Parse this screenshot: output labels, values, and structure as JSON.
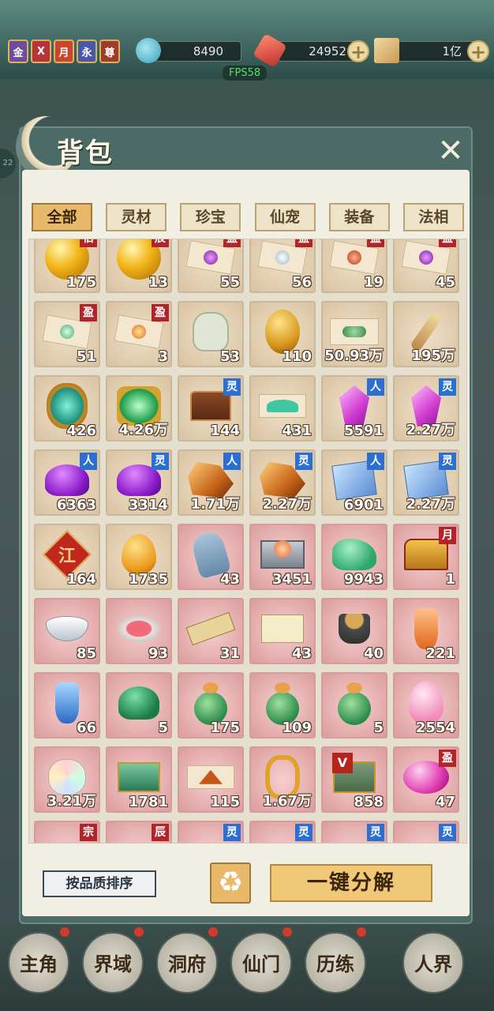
{
  "header": {
    "badges": [
      {
        "label": "金",
        "color": "#6e4b9c"
      },
      {
        "label": "X",
        "color": "#b8343a"
      },
      {
        "label": "月",
        "color": "#c9452f"
      },
      {
        "label": "永",
        "color": "#4a58a8"
      },
      {
        "label": "尊",
        "color": "#a03a2a"
      }
    ],
    "resources": [
      {
        "name": "spirit-jade",
        "value": "8490",
        "color": "#3aa0b8"
      },
      {
        "name": "red-crystal",
        "value": "24952",
        "color": "#d2453a"
      },
      {
        "name": "scroll",
        "value": "1亿",
        "color": "#d8b06a"
      }
    ],
    "plus_label": "+",
    "fps": "FPS58"
  },
  "panel": {
    "title": "背包",
    "close_label": "✕",
    "side_number": "22",
    "tabs": [
      {
        "label": "全部",
        "active": true
      },
      {
        "label": "灵材",
        "active": false
      },
      {
        "label": "珍宝",
        "active": false
      },
      {
        "label": "仙宠",
        "active": false
      },
      {
        "label": "装备",
        "active": false
      },
      {
        "label": "法相",
        "active": false
      }
    ],
    "items": [
      {
        "icon": "yellow-orb",
        "count": "175",
        "tag": "佰",
        "tagColor": "red",
        "bg": "tan"
      },
      {
        "icon": "yellow-orb",
        "count": "13",
        "tag": "辰",
        "tagColor": "red",
        "bg": "tan"
      },
      {
        "icon": "purple-pill-cloth",
        "count": "55",
        "tag": "盈",
        "tagColor": "red",
        "bg": "tan"
      },
      {
        "icon": "white-pill-cloth",
        "count": "56",
        "tag": "盈",
        "tagColor": "red",
        "bg": "tan"
      },
      {
        "icon": "red-pill-cloth",
        "count": "19",
        "tag": "盈",
        "tagColor": "red",
        "bg": "tan"
      },
      {
        "icon": "purple-pill-cloth",
        "count": "45",
        "tag": "盈",
        "tagColor": "red",
        "bg": "tan"
      },
      {
        "icon": "green-pill-cloth",
        "count": "51",
        "tag": "盈",
        "tagColor": "red",
        "bg": "tan"
      },
      {
        "icon": "orange-pill-cloth",
        "count": "3",
        "tag": "盈",
        "tagColor": "red",
        "bg": "tan"
      },
      {
        "icon": "jade-pendant",
        "count": "53",
        "tag": "",
        "tagColor": "",
        "bg": "tan"
      },
      {
        "icon": "amber-stone",
        "count": "110",
        "tag": "",
        "tagColor": "",
        "bg": "tan"
      },
      {
        "icon": "green-pills-cloth",
        "count": "50.93万",
        "tag": "",
        "tagColor": "",
        "bg": "tan"
      },
      {
        "icon": "ginseng-root",
        "count": "195万",
        "tag": "",
        "tagColor": "",
        "bg": "tan"
      },
      {
        "icon": "jade-amulet",
        "count": "426",
        "tag": "",
        "tagColor": "",
        "bg": "tan"
      },
      {
        "icon": "emerald-gem",
        "count": "4.26万",
        "tag": "",
        "tagColor": "",
        "bg": "tan"
      },
      {
        "icon": "treasure-chest",
        "count": "144",
        "tag": "灵",
        "tagColor": "blue",
        "bg": "tan"
      },
      {
        "icon": "jade-powder",
        "count": "431",
        "tag": "",
        "tagColor": "",
        "bg": "tan"
      },
      {
        "icon": "pink-crystal",
        "count": "5591",
        "tag": "人",
        "tagColor": "blue",
        "bg": "tan"
      },
      {
        "icon": "pink-crystal",
        "count": "2.27万",
        "tag": "灵",
        "tagColor": "blue",
        "bg": "tan"
      },
      {
        "icon": "purple-mushroom",
        "count": "6363",
        "tag": "人",
        "tagColor": "blue",
        "bg": "tan"
      },
      {
        "icon": "purple-mushroom",
        "count": "3314",
        "tag": "灵",
        "tagColor": "blue",
        "bg": "tan"
      },
      {
        "icon": "orange-ore",
        "count": "1.71万",
        "tag": "人",
        "tagColor": "blue",
        "bg": "tan"
      },
      {
        "icon": "orange-ore",
        "count": "2.27万",
        "tag": "灵",
        "tagColor": "blue",
        "bg": "tan"
      },
      {
        "icon": "blue-cloth",
        "count": "6901",
        "tag": "人",
        "tagColor": "blue",
        "bg": "tan"
      },
      {
        "icon": "blue-cloth",
        "count": "2.27万",
        "tag": "灵",
        "tagColor": "blue",
        "bg": "tan"
      },
      {
        "icon": "red-seal",
        "count": "164",
        "tag": "",
        "tagColor": "",
        "bg": "tan"
      },
      {
        "icon": "orange-drop",
        "count": "1735",
        "tag": "",
        "tagColor": "",
        "bg": "tan"
      },
      {
        "icon": "blue-pouch",
        "count": "43",
        "tag": "",
        "tagColor": "",
        "bg": "pink"
      },
      {
        "icon": "open-box",
        "count": "3451",
        "tag": "",
        "tagColor": "",
        "bg": "pink"
      },
      {
        "icon": "jade-beast",
        "count": "9943",
        "tag": "",
        "tagColor": "",
        "bg": "pink"
      },
      {
        "icon": "golden-chest",
        "count": "1",
        "tag": "月",
        "tagColor": "red",
        "bg": "pink"
      },
      {
        "icon": "white-bowl",
        "count": "85",
        "tag": "",
        "tagColor": "",
        "bg": "pink"
      },
      {
        "icon": "rouge-box",
        "count": "93",
        "tag": "",
        "tagColor": "",
        "bg": "pink"
      },
      {
        "icon": "brush-scroll",
        "count": "31",
        "tag": "",
        "tagColor": "",
        "bg": "pink"
      },
      {
        "icon": "paper-scroll",
        "count": "43",
        "tag": "",
        "tagColor": "",
        "bg": "pink"
      },
      {
        "icon": "tea-cup",
        "count": "40",
        "tag": "",
        "tagColor": "",
        "bg": "pink"
      },
      {
        "icon": "orange-bottle",
        "count": "221",
        "tag": "",
        "tagColor": "",
        "bg": "pink"
      },
      {
        "icon": "blue-bottle",
        "count": "66",
        "tag": "",
        "tagColor": "",
        "bg": "pink"
      },
      {
        "icon": "green-toad",
        "count": "5",
        "tag": "",
        "tagColor": "",
        "bg": "pink"
      },
      {
        "icon": "seed-bag",
        "count": "175",
        "tag": "",
        "tagColor": "",
        "bg": "pink"
      },
      {
        "icon": "seed-bag",
        "count": "109",
        "tag": "",
        "tagColor": "",
        "bg": "pink"
      },
      {
        "icon": "seed-bag",
        "count": "5",
        "tag": "",
        "tagColor": "",
        "bg": "pink"
      },
      {
        "icon": "pink-egg",
        "count": "2554",
        "tag": "",
        "tagColor": "",
        "bg": "pink"
      },
      {
        "icon": "rainbow-stone",
        "count": "3.21万",
        "tag": "",
        "tagColor": "",
        "bg": "pink"
      },
      {
        "icon": "green-box",
        "count": "1781",
        "tag": "",
        "tagColor": "",
        "bg": "pink"
      },
      {
        "icon": "red-mountain-cloth",
        "count": "115",
        "tag": "",
        "tagColor": "",
        "bg": "pink"
      },
      {
        "icon": "golden-dragon",
        "count": "1.67万",
        "tag": "",
        "tagColor": "",
        "bg": "pink"
      },
      {
        "icon": "wrapped-chest",
        "count": "858",
        "tag": "",
        "tagColor": "",
        "bg": "pink"
      },
      {
        "icon": "magenta-gem",
        "count": "47",
        "tag": "盈",
        "tagColor": "red",
        "bg": "pink"
      },
      {
        "icon": "",
        "count": "",
        "tag": "宗",
        "tagColor": "red",
        "bg": "pink"
      },
      {
        "icon": "",
        "count": "",
        "tag": "辰",
        "tagColor": "red",
        "bg": "pink"
      },
      {
        "icon": "",
        "count": "",
        "tag": "灵",
        "tagColor": "blue",
        "bg": "pink"
      },
      {
        "icon": "",
        "count": "",
        "tag": "灵",
        "tagColor": "blue",
        "bg": "pink"
      },
      {
        "icon": "",
        "count": "",
        "tag": "灵",
        "tagColor": "blue",
        "bg": "pink"
      },
      {
        "icon": "",
        "count": "",
        "tag": "灵",
        "tagColor": "blue",
        "bg": "pink"
      }
    ],
    "sort_label": "按品质排序",
    "recycle_label": "♻",
    "decompose_label": "一键分解"
  },
  "bottom_nav": [
    {
      "label": "主角"
    },
    {
      "label": "界域"
    },
    {
      "label": "洞府"
    },
    {
      "label": "仙门"
    },
    {
      "label": "历练"
    },
    {
      "label": "人界"
    }
  ]
}
